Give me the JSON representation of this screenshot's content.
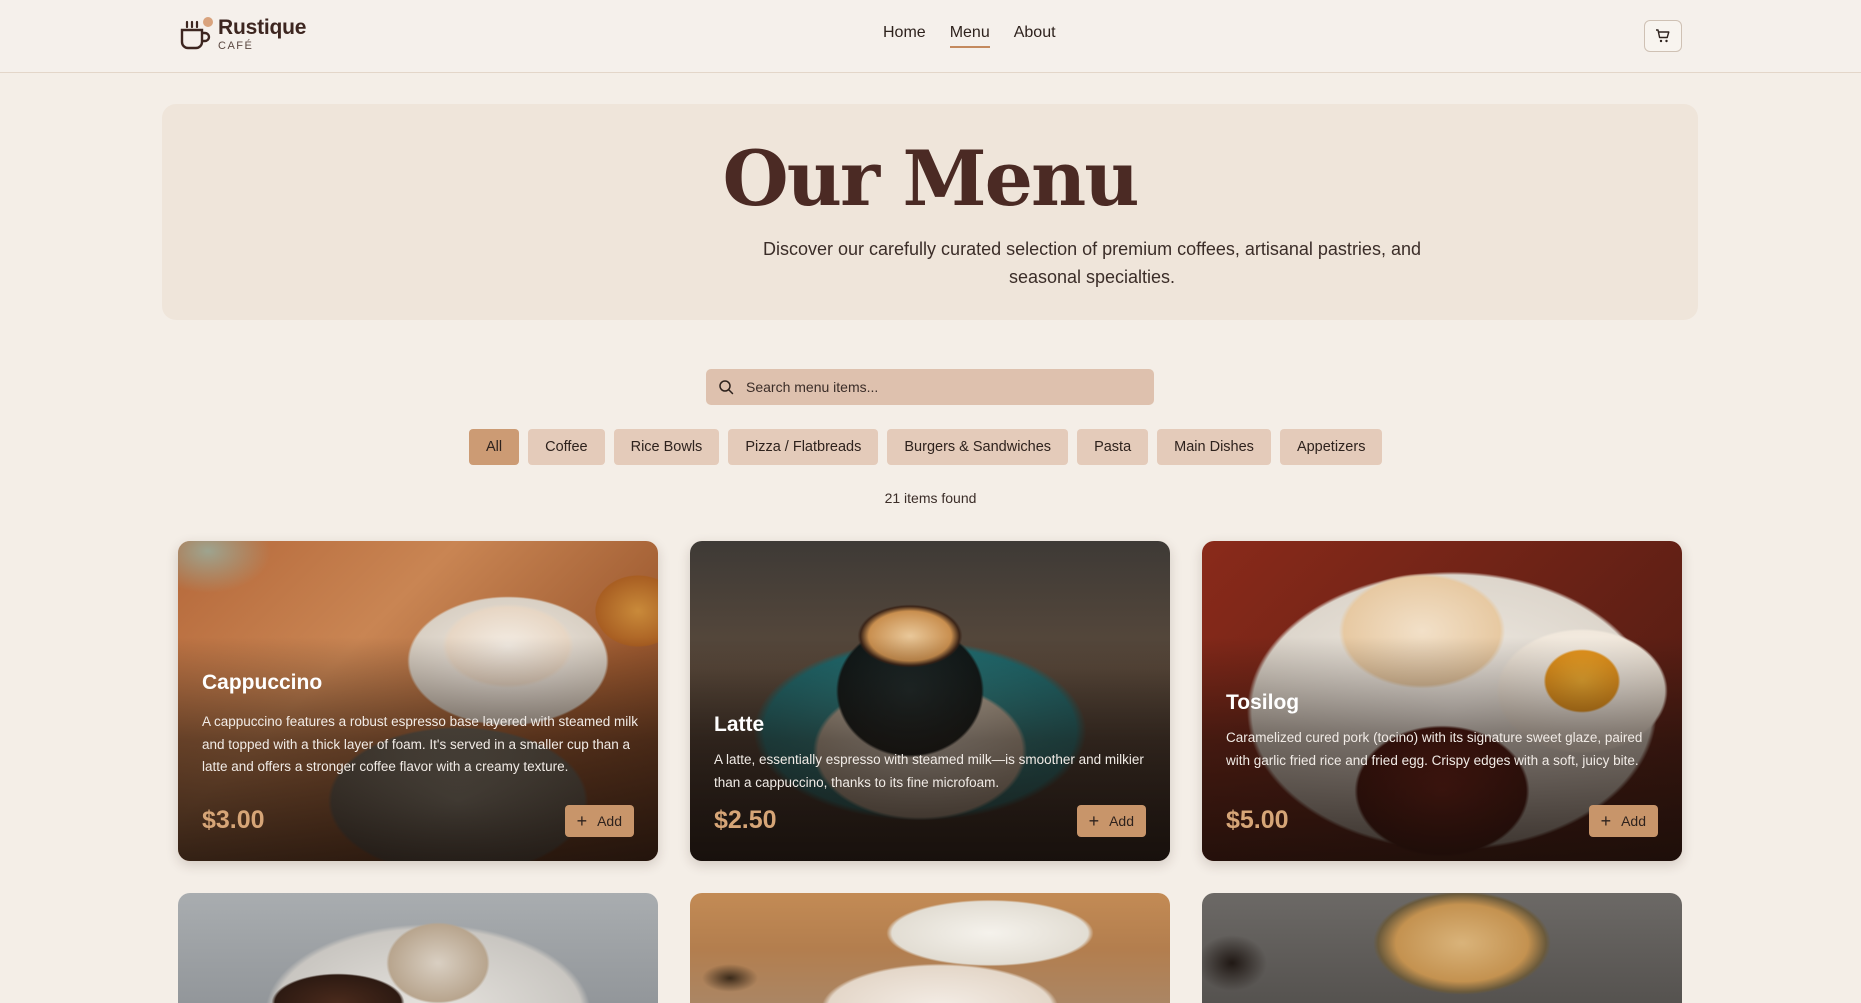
{
  "brand": {
    "name": "Rustique",
    "sub": "CAFÉ"
  },
  "nav": {
    "items": [
      "Home",
      "Menu",
      "About"
    ],
    "active": "Menu"
  },
  "icons": {
    "logo": "coffee-cup-icon",
    "cart": "cart-icon",
    "search": "search-icon",
    "add": "plus-icon"
  },
  "hero": {
    "title": "Our Menu",
    "description": "Discover our carefully curated selection of premium coffees, artisanal pastries, and seasonal specialties."
  },
  "search": {
    "placeholder": "Search menu items..."
  },
  "filters": {
    "items": [
      "All",
      "Coffee",
      "Rice Bowls",
      "Pizza / Flatbreads",
      "Burgers & Sandwiches",
      "Pasta",
      "Main Dishes",
      "Appetizers"
    ],
    "active": "All"
  },
  "count_text": "21 items found",
  "cards": [
    {
      "title": "Cappuccino",
      "description": "A cappuccino features a robust espresso base layered with steamed milk and topped with a thick layer of foam. It's served in a smaller cup than a latte and offers a stronger coffee flavor with a creamy texture.",
      "price": "$3.00",
      "add_label": "Add"
    },
    {
      "title": "Latte",
      "description": "A latte, essentially espresso with steamed milk—is smoother and milkier than a cappuccino, thanks to its fine microfoam.",
      "price": "$2.50",
      "add_label": "Add"
    },
    {
      "title": "Tosilog",
      "description": "Caramelized cured pork (tocino) with its signature sweet glaze, paired with garlic fried rice and fried egg. Crispy edges with a soft, juicy bite.",
      "price": "$5.00",
      "add_label": "Add"
    }
  ],
  "colors": {
    "accent": "#c8956a",
    "chip": "#e4cbba",
    "chip_active": "#cc9b74",
    "title": "#4b2a24",
    "price": "#d6a577"
  }
}
